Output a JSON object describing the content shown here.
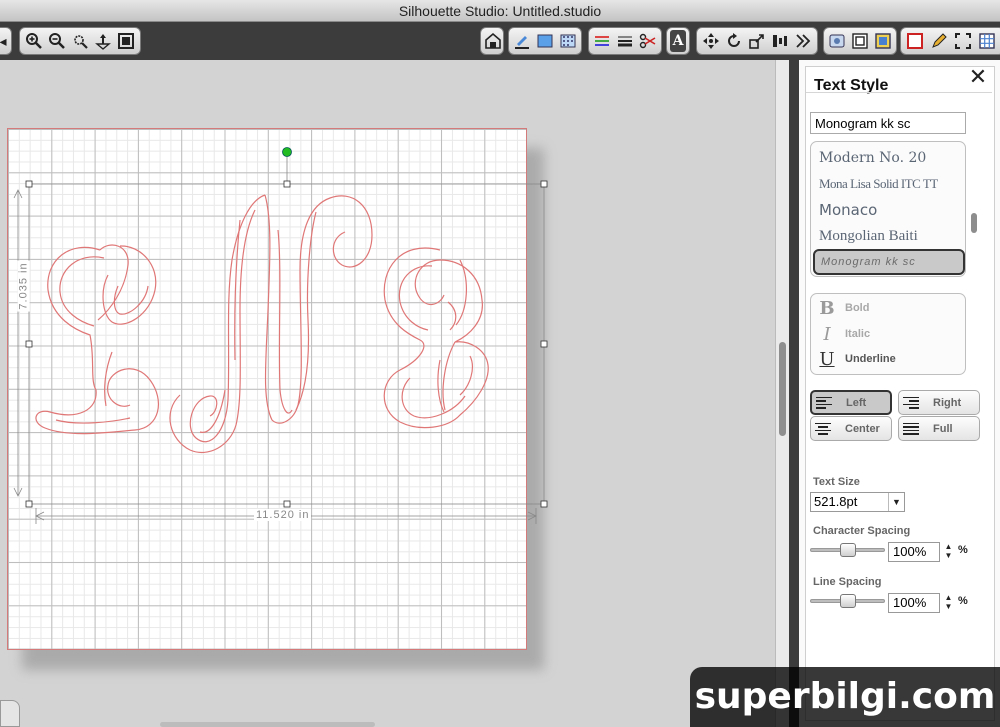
{
  "window": {
    "title": "Silhouette Studio: Untitled.studio"
  },
  "canvas": {
    "width_label": "11.520 in",
    "height_label": "7.035 in",
    "monogram_text": "LNB"
  },
  "panel": {
    "title": "Text Style",
    "font_input_value": "Monogram kk sc",
    "font_list": [
      "Modern No. 20",
      "Mona Lisa Solid ITC TT",
      "Monaco",
      "Mongolian Baiti"
    ],
    "selected_font": "Monogram kk sc",
    "styles": {
      "bold": "Bold",
      "italic": "Italic",
      "underline": "Underline"
    },
    "style_glyphs": {
      "bold": "B",
      "italic": "I",
      "underline": "U"
    },
    "alignment": {
      "left": "Left",
      "right": "Right",
      "center": "Center",
      "full": "Full",
      "selected": "Left"
    },
    "text_size_label": "Text Size",
    "text_size_value": "521.8pt",
    "char_spacing_label": "Character Spacing",
    "char_spacing_value": "100%",
    "line_spacing_label": "Line Spacing",
    "line_spacing_value": "100%",
    "percent_unit": "%"
  },
  "watermark": "superbilgi.com",
  "colors": {
    "cut_line": "#e07777",
    "handle_rotate": "#22bb22",
    "toolbar_bg": "#3c3c3c"
  }
}
